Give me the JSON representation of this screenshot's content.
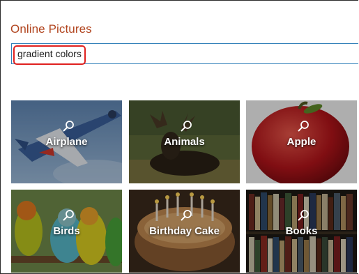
{
  "dialog": {
    "title": "Online Pictures",
    "search": {
      "value": "gradient colors"
    }
  },
  "categories": [
    {
      "label": "Airplane"
    },
    {
      "label": "Animals"
    },
    {
      "label": "Apple"
    },
    {
      "label": "Birds"
    },
    {
      "label": "Birthday Cake"
    },
    {
      "label": "Books"
    }
  ],
  "colors": {
    "title": "#b1441e",
    "search_border": "#2f7fb8",
    "highlight": "#e0201e"
  }
}
